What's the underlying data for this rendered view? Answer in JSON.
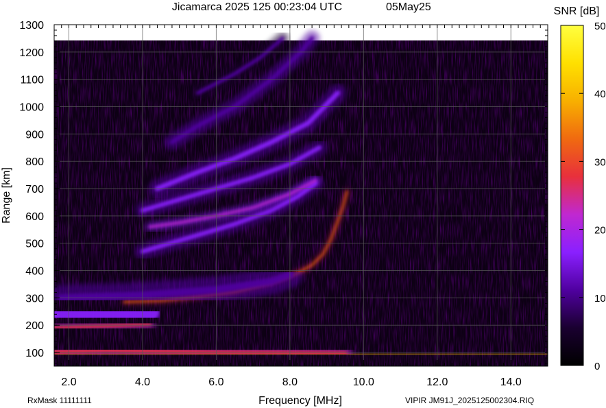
{
  "header": {
    "title": "Jicamarca 2025 125 00:23:04 UTC",
    "date_label": "05May25"
  },
  "footer": {
    "left": "RxMask 11111111",
    "right": "VIPIR  JM91J_2025125002304.RIQ"
  },
  "colorbar": {
    "label": "SNR [dB]",
    "min": 0,
    "max": 50,
    "ticks": [
      "0",
      "10",
      "20",
      "30",
      "40",
      "50"
    ],
    "stops": [
      "#000000",
      "#1a0030",
      "#5000a0",
      "#8a20ff",
      "#c028d0",
      "#e8303c",
      "#f06a10",
      "#f8b000",
      "#ffe000",
      "#ffff40"
    ]
  },
  "chart_data": {
    "type": "heatmap",
    "title": "Jicamarca 2025 125 00:23:04 UTC",
    "subtitle": "05May25",
    "xlabel": "Frequency [MHz]",
    "ylabel": "Range [km]",
    "xlim": [
      1.6,
      15.0
    ],
    "ylim": [
      50,
      1300
    ],
    "x_ticks": [
      "2.0",
      "4.0",
      "6.0",
      "8.0",
      "10.0",
      "12.0",
      "14.0"
    ],
    "y_ticks": [
      "100",
      "200",
      "300",
      "400",
      "500",
      "600",
      "700",
      "800",
      "900",
      "1000",
      "1100",
      "1200",
      "1300"
    ],
    "grid": true,
    "colorbar": {
      "label": "SNR [dB]",
      "range": [
        0,
        50
      ]
    },
    "traces": [
      {
        "points": [
          [
            1.6,
            92
          ],
          [
            3.0,
            94
          ],
          [
            4.5,
            95
          ],
          [
            6.0,
            96
          ],
          [
            9.0,
            96
          ],
          [
            15.0,
            96
          ]
        ],
        "snr": 44,
        "width": 2
      },
      {
        "points": [
          [
            1.6,
            102
          ],
          [
            3.0,
            108
          ],
          [
            4.5,
            104
          ],
          [
            6.0,
            100
          ],
          [
            8.0,
            98
          ],
          [
            9.5,
            96
          ]
        ],
        "snr": 30,
        "width": 14
      },
      {
        "points": [
          [
            1.6,
            190
          ],
          [
            2.5,
            195
          ],
          [
            3.5,
            200
          ],
          [
            4.2,
            205
          ]
        ],
        "snr": 28,
        "width": 10
      },
      {
        "points": [
          [
            1.6,
            230
          ],
          [
            2.5,
            240
          ],
          [
            3.5,
            245
          ],
          [
            4.2,
            248
          ]
        ],
        "snr": 16,
        "width": 60
      },
      {
        "points": [
          [
            3.5,
            285
          ],
          [
            4.5,
            290
          ],
          [
            5.5,
            305
          ],
          [
            6.5,
            322
          ],
          [
            7.5,
            355
          ],
          [
            8.2,
            390
          ],
          [
            8.6,
            420
          ],
          [
            8.9,
            460
          ],
          [
            9.1,
            510
          ],
          [
            9.3,
            580
          ],
          [
            9.45,
            640
          ],
          [
            9.55,
            690
          ]
        ],
        "snr": 36,
        "width": 4
      },
      {
        "points": [
          [
            1.8,
            300
          ],
          [
            3.0,
            305
          ],
          [
            4.0,
            310
          ],
          [
            6.0,
            330
          ],
          [
            7.5,
            360
          ],
          [
            8.0,
            385
          ]
        ],
        "snr": 12,
        "width": 24
      },
      {
        "points": [
          [
            4.0,
            470
          ],
          [
            4.5,
            490
          ],
          [
            5.5,
            530
          ],
          [
            6.5,
            570
          ],
          [
            7.5,
            620
          ],
          [
            8.2,
            670
          ],
          [
            8.7,
            720
          ]
        ],
        "snr": 16,
        "width": 14
      },
      {
        "points": [
          [
            4.2,
            560
          ],
          [
            5.0,
            575
          ],
          [
            6.0,
            600
          ],
          [
            7.0,
            630
          ],
          [
            8.0,
            680
          ],
          [
            8.7,
            730
          ]
        ],
        "snr": 22,
        "width": 8
      },
      {
        "points": [
          [
            4.0,
            620
          ],
          [
            5.0,
            660
          ],
          [
            6.0,
            700
          ],
          [
            7.0,
            740
          ],
          [
            8.0,
            790
          ],
          [
            8.8,
            850
          ]
        ],
        "snr": 17,
        "width": 14
      },
      {
        "points": [
          [
            4.4,
            700
          ],
          [
            5.5,
            760
          ],
          [
            6.5,
            810
          ],
          [
            7.5,
            870
          ],
          [
            8.5,
            940
          ],
          [
            9.3,
            1050
          ]
        ],
        "snr": 14,
        "width": 16
      },
      {
        "points": [
          [
            4.8,
            870
          ],
          [
            5.5,
            930
          ],
          [
            6.5,
            1000
          ],
          [
            7.5,
            1100
          ],
          [
            8.3,
            1200
          ],
          [
            8.6,
            1250
          ]
        ],
        "snr": 12,
        "width": 14
      },
      {
        "points": [
          [
            5.5,
            1050
          ],
          [
            6.5,
            1120
          ],
          [
            7.2,
            1180
          ],
          [
            7.8,
            1250
          ]
        ],
        "snr": 11,
        "width": 12
      }
    ]
  }
}
